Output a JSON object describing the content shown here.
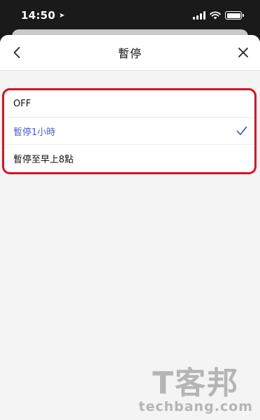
{
  "status_bar": {
    "time": "14:50",
    "location_icon": "location-arrow-icon",
    "icons": [
      "signal-icon",
      "wifi-icon",
      "battery-icon"
    ]
  },
  "sheet": {
    "title": "暫停",
    "back_icon": "chevron-left-icon",
    "close_icon": "close-icon"
  },
  "options": [
    {
      "label": "OFF",
      "selected": false
    },
    {
      "label": "暫停1小時",
      "selected": true
    },
    {
      "label": "暫停至早上8點",
      "selected": false
    }
  ],
  "watermark": {
    "brand": "T客邦",
    "domain": "techbang.com"
  },
  "colors": {
    "selected_text": "#4a63c7",
    "highlight_border": "#d9111f",
    "sheet_background": "#f4f4f4"
  }
}
